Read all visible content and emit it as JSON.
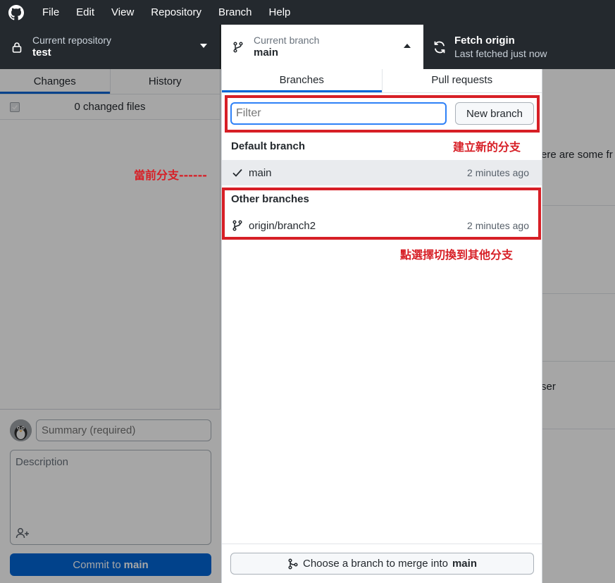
{
  "menu": {
    "items": [
      "File",
      "Edit",
      "View",
      "Repository",
      "Branch",
      "Help"
    ]
  },
  "toolbar": {
    "repo_label": "Current repository",
    "repo_name": "test",
    "branch_label": "Current branch",
    "branch_name": "main",
    "fetch_title": "Fetch origin",
    "fetch_sub": "Last fetched just now"
  },
  "left_pane": {
    "tabs": [
      "Changes",
      "History"
    ],
    "changes_count": "0 changed files",
    "summary_placeholder": "Summary (required)",
    "description_placeholder": "Description",
    "commit_prefix": "Commit to",
    "commit_branch": "main"
  },
  "right_pane": {
    "fragments": [
      "ere are some fr",
      "ser"
    ]
  },
  "branch_popover": {
    "tabs": [
      "Branches",
      "Pull requests"
    ],
    "filter_placeholder": "Filter",
    "new_branch_label": "New branch",
    "default_header": "Default branch",
    "other_header": "Other branches",
    "default_branches": [
      {
        "name": "main",
        "time": "2 minutes ago"
      }
    ],
    "other_branches": [
      {
        "name": "origin/branch2",
        "time": "2 minutes ago"
      }
    ],
    "merge_prefix": "Choose a branch to merge into",
    "merge_branch": "main"
  },
  "annotations": {
    "new_branch": "建立新的分支",
    "current_branch": "當前分支------",
    "switch_branch": "點選擇切換到其他分支"
  },
  "colors": {
    "accent": "#0366d6",
    "annotation": "#d71f26",
    "toolbar_bg": "#24292e"
  }
}
